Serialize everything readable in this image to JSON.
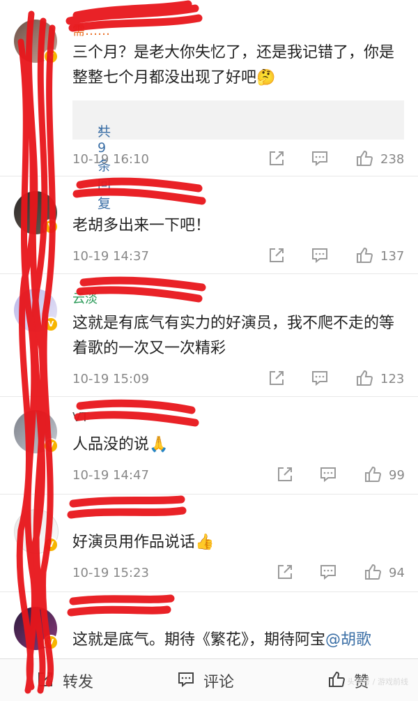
{
  "comments": [
    {
      "name": "需……",
      "text": "三个月？是老大你失忆了，还是我记错了，你是整整七个月都没出现了好吧",
      "emoji": "🤔",
      "reply_label": "共9条回复",
      "reply_chevron": "›",
      "time": "10-19 16:10",
      "likes": "238"
    },
    {
      "name": "",
      "text": "老胡多出来一下吧！",
      "emoji": "",
      "time": "10-19 14:37",
      "likes": "137"
    },
    {
      "name": "云淡",
      "text": "这就是有底气有实力的好演员，我不爬不走的等着歌的一次又一次精彩",
      "emoji": "",
      "time": "10-19 15:09",
      "likes": "123"
    },
    {
      "name": "VT",
      "text": "人品没的说",
      "emoji": "🙏",
      "time": "10-19 14:47",
      "likes": "99"
    },
    {
      "name": "",
      "text": "好演员用作品说话",
      "emoji": "👍",
      "time": "10-19 15:23",
      "likes": "94"
    },
    {
      "name": "",
      "text": "这就是底气。期待《繁花》，期待阿宝",
      "mention": "@胡歌",
      "time": "",
      "likes": ""
    }
  ],
  "bottom_bar": {
    "repost_label": "转发",
    "comment_label": "评论",
    "like_label": "赞"
  },
  "watermark": "头条号 / 游戏前线",
  "colors": {
    "accent_link": "#3a6ea5",
    "name_orange": "#e86b1f",
    "badge": "#f7b500",
    "redaction": "#e8161b"
  }
}
